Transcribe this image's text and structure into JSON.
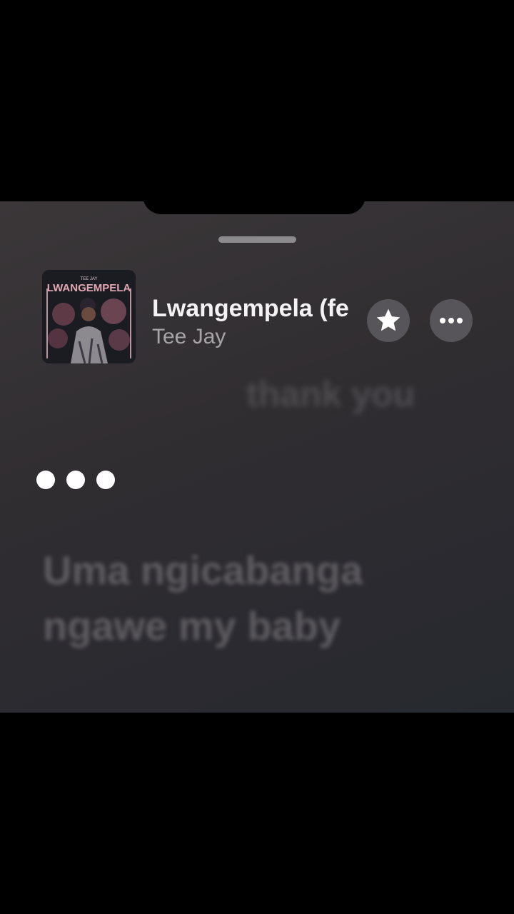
{
  "now_playing": {
    "title": "Lwangempela (feat. ...)",
    "title_visible": "Lwangempela (fe",
    "artist": "Tee Jay",
    "artwork": {
      "album_label": "LWANGEMPELA",
      "artist_label": "TEE JAY"
    }
  },
  "controls": {
    "favorite_icon": "star-icon",
    "more_icon": "ellipsis-icon"
  },
  "lyrics": {
    "previous_line": "thank you",
    "current_state": "instrumental-pause",
    "next_line": "Uma ngicabanga ngawe my baby"
  },
  "colors": {
    "background": "#000000",
    "panel": "#322f33",
    "title": "#f4f2f3",
    "artist": "#a7a4a7",
    "button": "#57545a"
  }
}
